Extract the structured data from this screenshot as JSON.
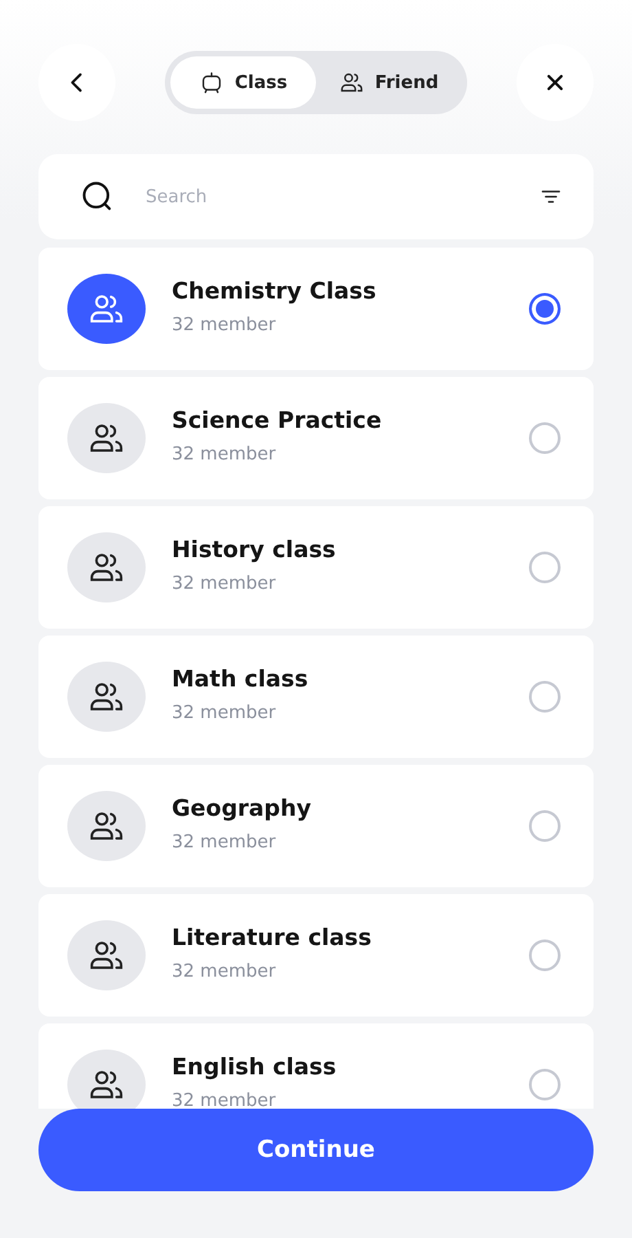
{
  "tabs": [
    {
      "label": "Class",
      "kind": "class",
      "selected": true
    },
    {
      "label": "Friend",
      "kind": "friend",
      "selected": false
    }
  ],
  "search": {
    "placeholder": "Search"
  },
  "items": [
    {
      "name": "Chemistry Class",
      "members": "32 member",
      "selected": true
    },
    {
      "name": "Science Practice",
      "members": "32 member",
      "selected": false
    },
    {
      "name": "History class",
      "members": "32 member",
      "selected": false
    },
    {
      "name": "Math class",
      "members": "32 member",
      "selected": false
    },
    {
      "name": "Geography",
      "members": "32 member",
      "selected": false
    },
    {
      "name": "Literature class",
      "members": "32 member",
      "selected": false
    },
    {
      "name": "English class",
      "members": "32 member",
      "selected": false
    }
  ],
  "continue_button": "Continue"
}
